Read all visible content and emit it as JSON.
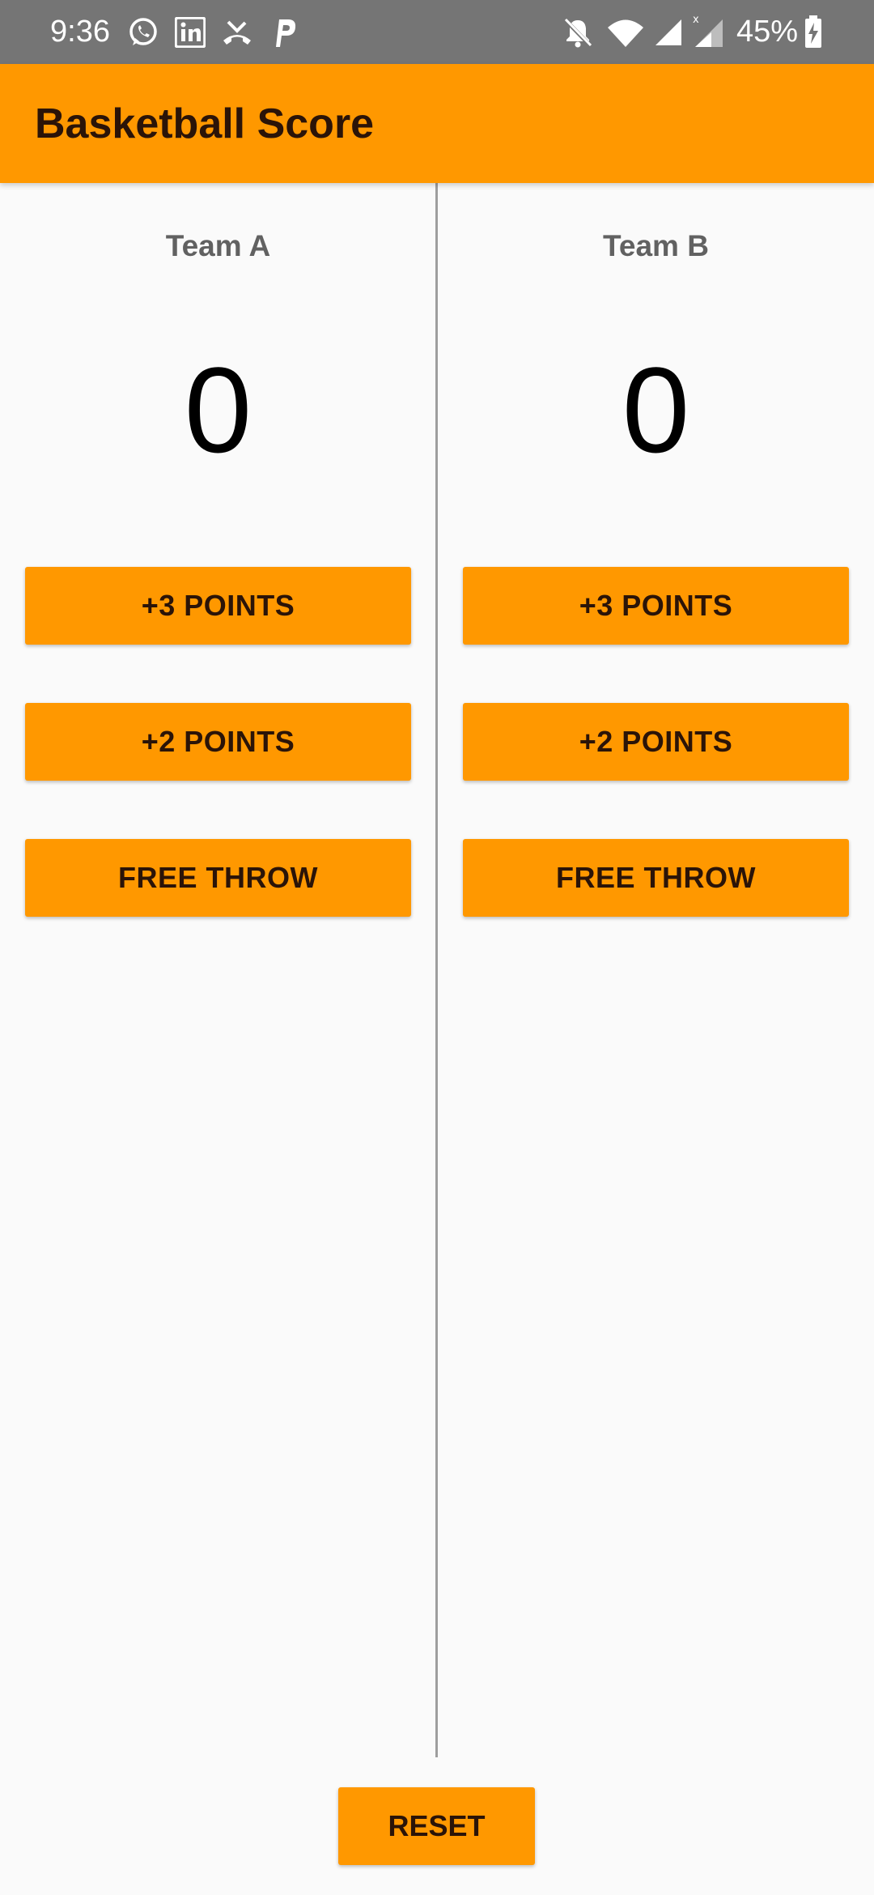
{
  "status_bar": {
    "time": "9:36",
    "battery": "45%",
    "icons": [
      "whatsapp-icon",
      "linkedin-icon",
      "missed-call-icon",
      "p-app-icon",
      "bell-off-icon",
      "wifi-icon",
      "signal-icon",
      "signal-no-data-icon",
      "battery-charging-icon"
    ]
  },
  "app_bar": {
    "title": "Basketball Score"
  },
  "team_a": {
    "name": "Team A",
    "score": "0",
    "btn_three": "+3 POINTS",
    "btn_two": "+2 POINTS",
    "btn_free": "FREE THROW"
  },
  "team_b": {
    "name": "Team B",
    "score": "0",
    "btn_three": "+3 POINTS",
    "btn_two": "+2 POINTS",
    "btn_free": "FREE THROW"
  },
  "reset_label": "RESET",
  "colors": {
    "accent": "#ff9800",
    "status_bar": "#757575",
    "background": "#fafafa",
    "button_text": "#2b1408"
  }
}
